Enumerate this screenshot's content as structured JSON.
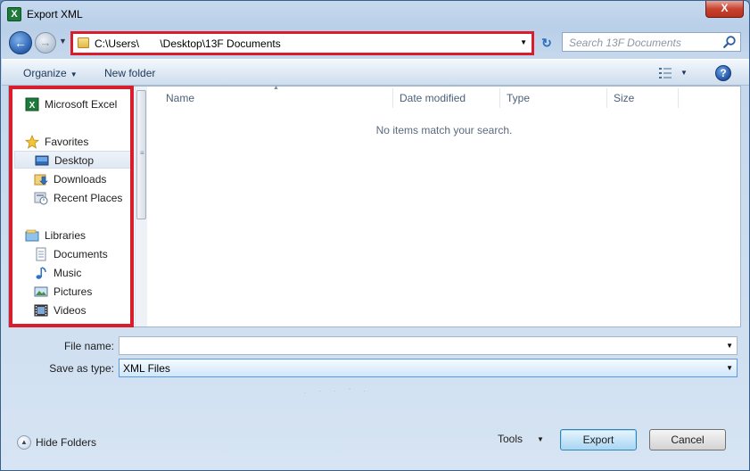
{
  "window": {
    "title": "Export XML",
    "title_icon": "excel-icon",
    "close_label": "X"
  },
  "navigation": {
    "address": "C:\\Users\\       \\Desktop\\13F Documents",
    "search_placeholder": "Search 13F Documents"
  },
  "toolbar": {
    "organize_label": "Organize",
    "new_folder_label": "New folder",
    "help_label": "?"
  },
  "sidebar": {
    "items": [
      {
        "label": "Microsoft Excel",
        "icon": "excel-icon"
      },
      {
        "label": "Favorites",
        "icon": "star-icon"
      },
      {
        "label": "Desktop",
        "icon": "desktop-icon",
        "selected": true
      },
      {
        "label": "Downloads",
        "icon": "downloads-icon"
      },
      {
        "label": "Recent Places",
        "icon": "recent-places-icon"
      },
      {
        "label": "Libraries",
        "icon": "libraries-icon"
      },
      {
        "label": "Documents",
        "icon": "documents-icon"
      },
      {
        "label": "Music",
        "icon": "music-icon"
      },
      {
        "label": "Pictures",
        "icon": "pictures-icon"
      },
      {
        "label": "Videos",
        "icon": "videos-icon"
      }
    ]
  },
  "file_list": {
    "columns": [
      "Name",
      "Date modified",
      "Type",
      "Size"
    ],
    "empty_message": "No items match your search."
  },
  "form": {
    "file_name_label": "File name:",
    "file_name_value": "",
    "save_type_label": "Save as type:",
    "save_type_value": "XML Files"
  },
  "footer": {
    "hide_folders_label": "Hide Folders",
    "tools_label": "Tools",
    "export_label": "Export",
    "cancel_label": "Cancel"
  },
  "colors": {
    "highlight": "#d81e2c",
    "accent": "#2a5fae"
  }
}
